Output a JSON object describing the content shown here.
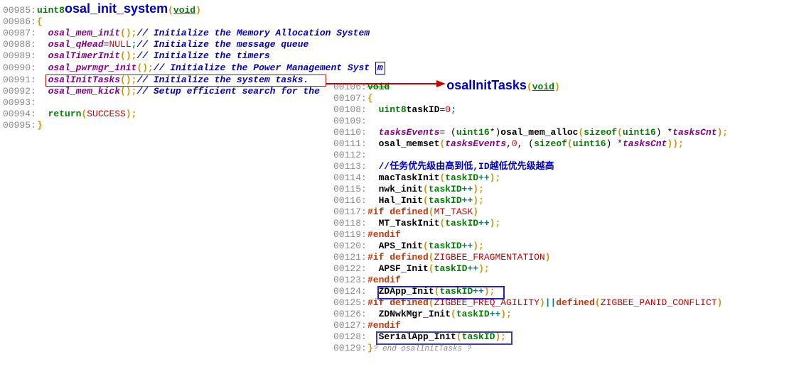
{
  "left": {
    "lines": {
      "l985_ln": "00985: ",
      "l985_type": "uint8",
      "l985_fn": " osal_init_system",
      "l985_p1": "( ",
      "l985_void": "void",
      "l985_p2": " )",
      "l986_ln": "00986: ",
      "l986_b": "{",
      "l987_ln": "00987: ",
      "l987_fn": "osal_mem_init",
      "l987_par": "();",
      "l987_c": "// Initialize the Memory Allocation System",
      "l988_ln": "00988: ",
      "l988_var": "osal_qHead",
      "l988_eq": " = ",
      "l988_null": "NULL",
      "l988_semi": ";",
      "l988_c": "// Initialize the message queue",
      "l989_ln": "00989: ",
      "l989_fn": "osalTimerInit",
      "l989_par": "();",
      "l989_c": "// Initialize the timers",
      "l990_ln": "00990: ",
      "l990_fn": "osal_pwrmgr_init",
      "l990_par": "();",
      "l990_c": "// Initialize the Power Management Syst",
      "l990_marker": "m",
      "l991_ln": "00991: ",
      "l991_fn": "osalInitTasks",
      "l991_par": "();",
      "l991_c": "// Initialize the system tasks.",
      "l992_ln": "00992: ",
      "l992_fn": "osal_mem_kick",
      "l992_par": "();",
      "l992_c": "// Setup efficient search for the",
      "l993_ln": "00993: ",
      "l994_ln": "00994: ",
      "l994_ret": "return",
      "l994_p1": " ( ",
      "l994_succ": "SUCCESS",
      "l994_p2": " );",
      "l995_ln": "00995: ",
      "l995_b": "}"
    }
  },
  "right": {
    "lines": {
      "l106_ln": "00106: ",
      "l106_void_strike": "void",
      "l106_fn": " osalInitTasks",
      "l106_p1": "( ",
      "l106_void": "void",
      "l106_p2": " )",
      "l107_ln": "00107: ",
      "l107_b": "{",
      "l108_ln": "00108: ",
      "l108_type": "uint8",
      "l108_var": " taskID",
      "l108_eq": " = ",
      "l108_num": "0",
      "l108_semi": ";",
      "l109_ln": "00109: ",
      "l110_ln": "00110: ",
      "l110_var1": "tasksEvents",
      "l110_eq": " = (",
      "l110_type": "uint16",
      "l110_cast": " *)",
      "l110_fn": "osal_mem_alloc",
      "l110_p1": "( ",
      "l110_sizeof": "sizeof",
      "l110_p2": "( ",
      "l110_type2": "uint16",
      "l110_p3": " ) * ",
      "l110_var2": "tasksCnt",
      "l110_p4": ");",
      "l111_ln": "00111: ",
      "l111_fn": "osal_memset",
      "l111_p1": "( ",
      "l111_var": "tasksEvents",
      "l111_comma": ", ",
      "l111_num": "0",
      "l111_comma2": ", (",
      "l111_sizeof": "sizeof",
      "l111_p2": "( ",
      "l111_type": "uint16",
      "l111_p3": " ) * ",
      "l111_var2": "tasksCnt",
      "l111_p4": "));",
      "l112_ln": "00112: ",
      "l113_ln": "00113: ",
      "l113_c": "//任务优先级由高到低,ID越低优先级越高",
      "l114_ln": "00114: ",
      "l114_fn": "macTaskInit",
      "l114_p1": "( ",
      "l114_var": "taskID",
      "l114_op": "++",
      "l114_p2": " );",
      "l115_ln": "00115: ",
      "l115_fn": "nwk_init",
      "l115_p1": "( ",
      "l115_var": "taskID",
      "l115_op": "++",
      "l115_p2": " );",
      "l116_ln": "00116: ",
      "l116_fn": "Hal_Init",
      "l116_p1": "( ",
      "l116_var": "taskID",
      "l116_op": "++",
      "l116_p2": " );",
      "l117_ln": "00117: ",
      "l117_pp": "#if defined",
      "l117_p1": "( ",
      "l117_d": "MT_TASK",
      "l117_p2": " )",
      "l118_ln": "00118: ",
      "l118_fn": "MT_TaskInit",
      "l118_p1": "( ",
      "l118_var": "taskID",
      "l118_op": "++",
      "l118_p2": " );",
      "l119_ln": "00119: ",
      "l119_pp": "#endif",
      "l120_ln": "00120: ",
      "l120_fn": "APS_Init",
      "l120_p1": "( ",
      "l120_var": "taskID",
      "l120_op": "++",
      "l120_p2": " );",
      "l121_ln": "00121: ",
      "l121_pp": "#if defined",
      "l121_p1": " ( ",
      "l121_d": "ZIGBEE_FRAGMENTATION",
      "l121_p2": " )",
      "l122_ln": "00122: ",
      "l122_fn": "APSF_Init",
      "l122_p1": "( ",
      "l122_var": "taskID",
      "l122_op": "++",
      "l122_p2": " );",
      "l123_ln": "00123: ",
      "l123_pp": "#endif",
      "l124_ln": "00124: ",
      "l124_fn": "ZDApp_Init",
      "l124_p1": "( ",
      "l124_var": "taskID",
      "l124_op": "++",
      "l124_p2": " );",
      "l125_ln": "00125: ",
      "l125_pp": "#if defined",
      "l125_p1": " ( ",
      "l125_d1": "ZIGBEE_FREQ_AGILITY",
      "l125_p2": " ) ",
      "l125_or": "||",
      "l125_pp2": " defined",
      "l125_p3": " ( ",
      "l125_d2": "ZIGBEE_PANID_CONFLICT",
      "l125_p4": " )",
      "l126_ln": "00126: ",
      "l126_fn": "ZDNwkMgr_Init",
      "l126_p1": "( ",
      "l126_var": "taskID",
      "l126_op": "++",
      "l126_p2": " );",
      "l127_ln": "00127: ",
      "l127_pp": "#endif",
      "l128_ln": "00128: ",
      "l128_fn": "SerialApp_Init",
      "l128_p1": "( ",
      "l128_var": "taskID",
      "l128_p2": " );",
      "l129_ln": "00129: ",
      "l129_b": "}",
      "l129_c": " ? end osalInitTasks ?"
    }
  }
}
